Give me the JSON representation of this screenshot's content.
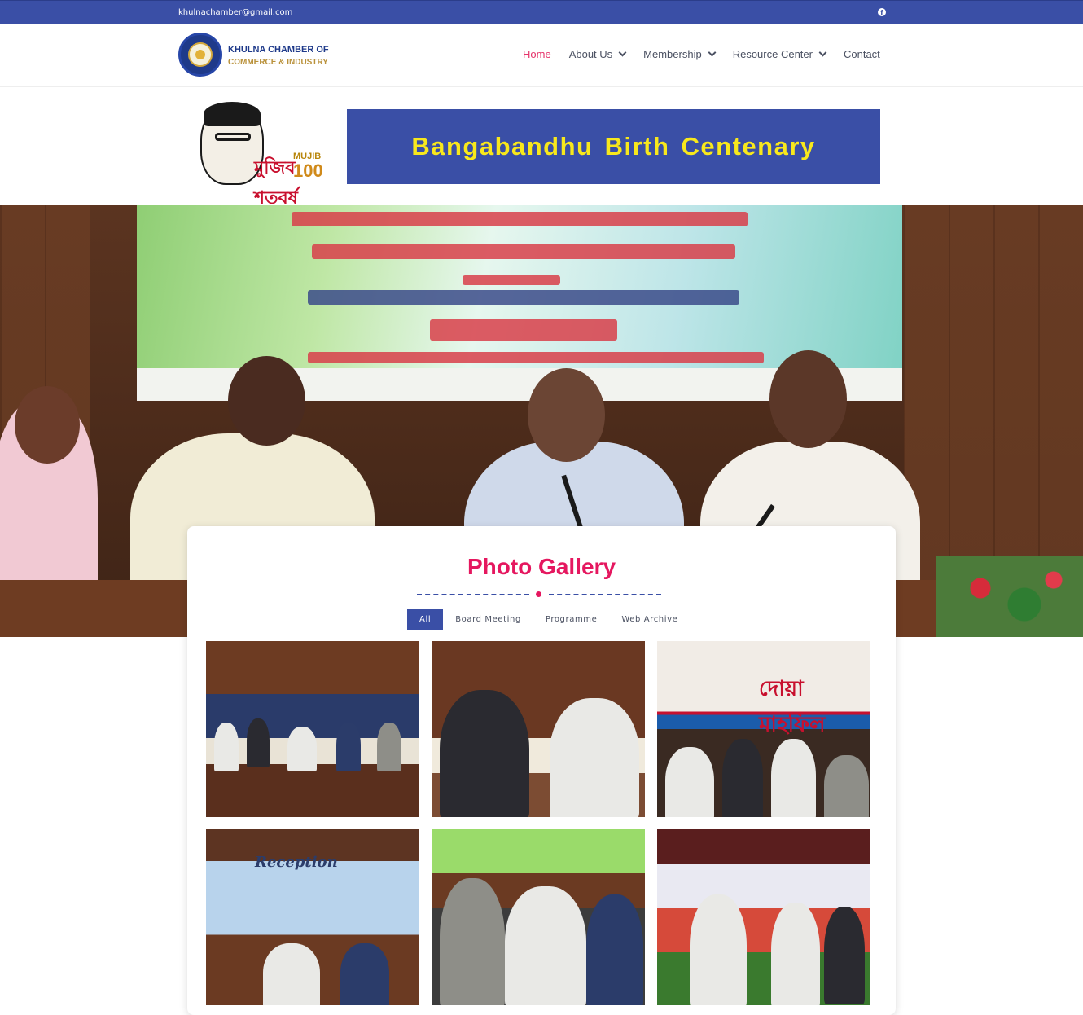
{
  "topbar": {
    "email": "khulnachamber@gmail.com",
    "social_icon": "facebook-icon"
  },
  "header": {
    "logo_line1": "KHULNA CHAMBER OF",
    "logo_line2": "COMMERCE & INDUSTRY",
    "nav": [
      {
        "label": "Home",
        "active": true,
        "dropdown": false
      },
      {
        "label": "About Us",
        "active": false,
        "dropdown": true
      },
      {
        "label": "Membership",
        "active": false,
        "dropdown": true
      },
      {
        "label": "Resource Center",
        "active": false,
        "dropdown": true
      },
      {
        "label": "Contact",
        "active": false,
        "dropdown": false
      }
    ]
  },
  "banner": {
    "mujib_bangla": "মুজিব শতবর্ষ",
    "mujib_label": "MUJIB",
    "mujib_number": "100",
    "centenary_text": "Bangabandhu Birth  Centenary"
  },
  "gallery": {
    "title": "Photo Gallery",
    "filters": [
      {
        "label": "All",
        "active": true
      },
      {
        "label": "Board Meeting",
        "active": false
      },
      {
        "label": "Programme",
        "active": false
      },
      {
        "label": "Web Archive",
        "active": false
      }
    ],
    "thumb_text": {
      "t3": "দোয়া মাহফিল",
      "t4": "Reception"
    }
  },
  "colors": {
    "brand_blue": "#3a4fa6",
    "accent_pink": "#e5175f",
    "banner_yellow": "#f8e81c"
  }
}
